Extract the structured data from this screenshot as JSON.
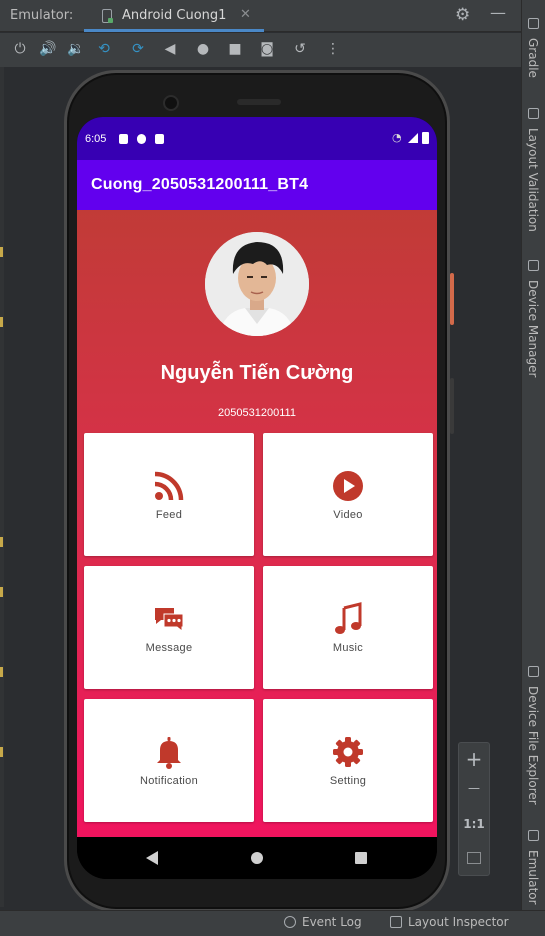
{
  "ide": {
    "panel_label": "Emulator:",
    "tab_label": "Android Cuong1",
    "tab_close": "✕",
    "settings_icon": "⚙",
    "minimize_icon": "—"
  },
  "toolbar": {
    "icons": [
      "power-icon",
      "volume-up-icon",
      "volume-down-icon",
      "rotate-left-icon",
      "rotate-right-icon",
      "back-icon",
      "home-icon",
      "overview-icon",
      "camera-icon",
      "snapshot-icon",
      "more-icon"
    ]
  },
  "sidebar": {
    "tabs": [
      "Gradle",
      "Layout Validation",
      "Device Manager",
      "Device File Explorer",
      "Emulator"
    ]
  },
  "statusbar": {
    "event_log": "Event Log",
    "layout_inspector": "Layout Inspector"
  },
  "zoom": {
    "zoom_in": "+",
    "zoom_out": "—",
    "actual_size": "1:1"
  },
  "device": {
    "time": "6:05",
    "app_title": "Cuong_2050531200111_BT4",
    "profile": {
      "name": "Nguyễn Tiến Cường",
      "student_id": "2050531200111"
    },
    "cards": [
      {
        "label": "Feed",
        "icon": "rss-icon"
      },
      {
        "label": "Video",
        "icon": "play-circle-icon"
      },
      {
        "label": "Message",
        "icon": "chat-icon"
      },
      {
        "label": "Music",
        "icon": "music-note-icon"
      },
      {
        "label": "Notification",
        "icon": "bell-icon"
      },
      {
        "label": "Setting",
        "icon": "gear-icon"
      }
    ],
    "colors": {
      "status_bar": "#3700b3",
      "app_bar": "#6200ee",
      "icon_accent": "#c0392b",
      "gradient_top": "#c13b37",
      "gradient_bottom": "#f0145e"
    }
  }
}
